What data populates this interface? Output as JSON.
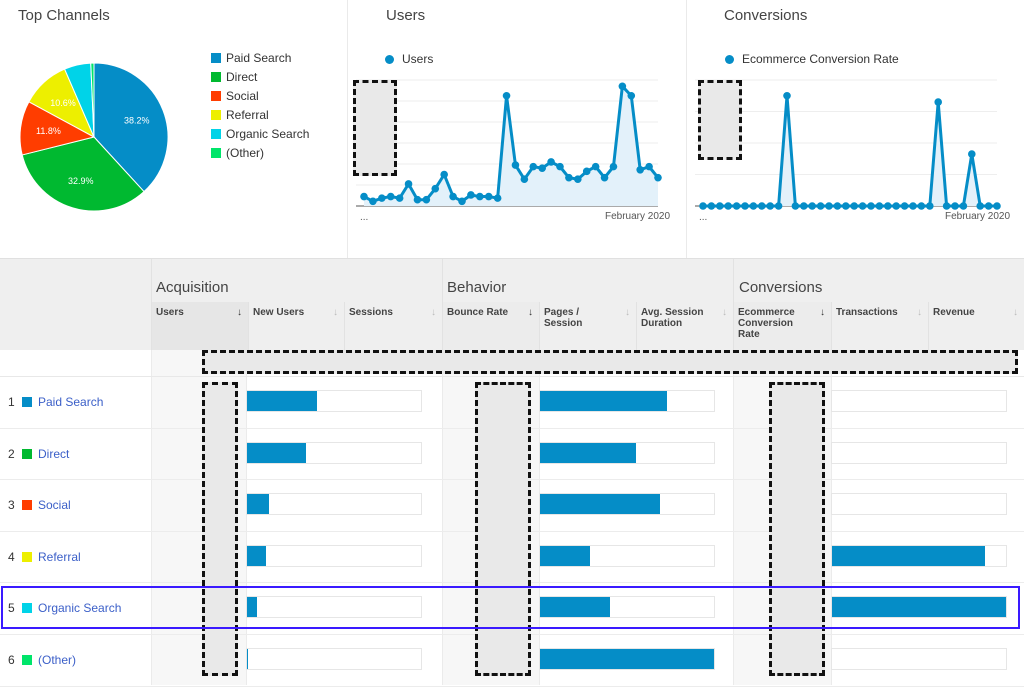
{
  "colors": {
    "accent": "#058dc7",
    "paid_search": "#058dc7",
    "direct": "#00b930",
    "social": "#ff3d00",
    "referral": "#edef00",
    "organic_search": "#00d3e8",
    "other": "#00e56a",
    "highlight": "#3a1aff",
    "link": "#3b5fc8"
  },
  "top_channels": {
    "title": "Top Channels",
    "legend": [
      "Paid Search",
      "Direct",
      "Social",
      "Referral",
      "Organic Search",
      "(Other)"
    ]
  },
  "users_panel": {
    "title": "Users",
    "legend": "Users",
    "x_start_label": "...",
    "x_end_label": "February 2020"
  },
  "conversions_panel": {
    "title": "Conversions",
    "legend": "Ecommerce Conversion Rate",
    "x_start_label": "...",
    "x_end_label": "February 2020"
  },
  "chart_data": [
    {
      "type": "pie",
      "title": "Top Channels",
      "categories": [
        "Paid Search",
        "Direct",
        "Social",
        "Referral",
        "Organic Search",
        "(Other)"
      ],
      "values": [
        38.2,
        32.9,
        11.8,
        10.6,
        5.8,
        0.7
      ],
      "labels": [
        "38.2%",
        "32.9%",
        "11.8%",
        "10.6%",
        "",
        ""
      ],
      "legend": "right"
    },
    {
      "type": "area",
      "title": "Users",
      "series": [
        {
          "name": "Users",
          "values": [
            6,
            3,
            5,
            6,
            5,
            14,
            4,
            4,
            11,
            20,
            6,
            3,
            7,
            6,
            6,
            5,
            70,
            26,
            17,
            25,
            24,
            28,
            25,
            18,
            17,
            22,
            25,
            18,
            25,
            76,
            70,
            23,
            25,
            18
          ]
        }
      ],
      "xlabel": "",
      "ylabel": "",
      "x_tick_labels": [
        "...",
        "February 2020"
      ],
      "ylim": [
        0,
        80
      ],
      "grid": true,
      "legend": "top-left"
    },
    {
      "type": "area",
      "title": "Conversions",
      "series": [
        {
          "name": "Ecommerce Conversion Rate",
          "values": [
            0,
            0,
            0,
            0,
            0,
            0,
            0,
            0,
            0,
            0,
            7,
            0,
            0,
            0,
            0,
            0,
            0,
            0,
            0,
            0,
            0,
            0,
            0,
            0,
            0,
            0,
            0,
            0,
            6.6,
            0,
            0,
            0,
            3.3,
            0,
            0,
            0
          ]
        }
      ],
      "xlabel": "",
      "ylabel": "",
      "x_tick_labels": [
        "...",
        "February 2020"
      ],
      "ylim": [
        0,
        8
      ],
      "grid": true,
      "legend": "top-left"
    }
  ],
  "table": {
    "groups": [
      "Acquisition",
      "Behavior",
      "Conversions"
    ],
    "columns": [
      {
        "label": "Users",
        "sort": "↓",
        "sorted": true
      },
      {
        "label": "New Users",
        "sort": "↓",
        "sorted": false
      },
      {
        "label": "Sessions",
        "sort": "↓",
        "sorted": false
      },
      {
        "label": "Bounce Rate",
        "sort": "↓",
        "sorted": true
      },
      {
        "label": "Pages / Session",
        "sort": "↓",
        "sorted": false
      },
      {
        "label": "Avg. Session Duration",
        "sort": "↓",
        "sorted": false
      },
      {
        "label": "Ecommerce Conversion Rate",
        "sort": "↓",
        "sorted": true
      },
      {
        "label": "Transactions",
        "sort": "↓",
        "sorted": false
      },
      {
        "label": "Revenue",
        "sort": "↓",
        "sorted": false
      }
    ],
    "rows": [
      {
        "num": "1",
        "channel": "Paid Search",
        "color": "#058dc7",
        "new_users_pct": 40,
        "pages_session_pct": 73,
        "transactions_pct": 0
      },
      {
        "num": "2",
        "channel": "Direct",
        "color": "#00b930",
        "new_users_pct": 34,
        "pages_session_pct": 55,
        "transactions_pct": 0
      },
      {
        "num": "3",
        "channel": "Social",
        "color": "#ff3d00",
        "new_users_pct": 12.5,
        "pages_session_pct": 69,
        "transactions_pct": 0
      },
      {
        "num": "4",
        "channel": "Referral",
        "color": "#edef00",
        "new_users_pct": 11,
        "pages_session_pct": 29,
        "transactions_pct": 88
      },
      {
        "num": "5",
        "channel": "Organic Search",
        "color": "#00d3e8",
        "new_users_pct": 6,
        "pages_session_pct": 40,
        "transactions_pct": 100
      },
      {
        "num": "6",
        "channel": "(Other)",
        "color": "#00e56a",
        "new_users_pct": 0.5,
        "pages_session_pct": 100,
        "transactions_pct": 0
      }
    ],
    "highlighted_row": "Organic Search"
  }
}
